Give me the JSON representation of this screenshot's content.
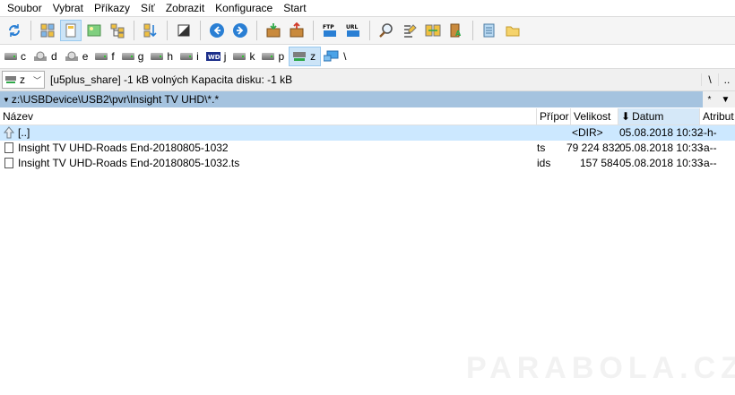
{
  "menu": [
    "Soubor",
    "Vybrat",
    "Příkazy",
    "Síť",
    "Zobrazit",
    "Konfigurace",
    "Start"
  ],
  "drives": [
    {
      "letter": "c",
      "icon": "hdd-icon"
    },
    {
      "letter": "d",
      "icon": "cd-drive-icon"
    },
    {
      "letter": "e",
      "icon": "cd-drive-icon"
    },
    {
      "letter": "f",
      "icon": "hdd-icon"
    },
    {
      "letter": "g",
      "icon": "hdd-icon"
    },
    {
      "letter": "h",
      "icon": "hdd-icon"
    },
    {
      "letter": "i",
      "icon": "hdd-icon"
    },
    {
      "letter": "j",
      "icon": "wd-drive-icon"
    },
    {
      "letter": "k",
      "icon": "hdd-icon"
    },
    {
      "letter": "p",
      "icon": "hdd-icon"
    },
    {
      "letter": "z",
      "icon": "network-drive-icon"
    },
    {
      "letter": "\\",
      "icon": "network-icon"
    }
  ],
  "drive_select": "z",
  "info": "[u5plus_share]  -1 kB volných  Kapacita disku: -1 kB",
  "info_right": [
    "\\",
    ".."
  ],
  "path": "z:\\USBDevice\\USB2\\pvr\\Insight TV UHD\\*.*",
  "path_right": [
    "*",
    "▼"
  ],
  "columns": {
    "name": "Název",
    "ext": "Přípor",
    "size": "Velikost",
    "date": "Datum",
    "attr": "Atribut"
  },
  "files": [
    {
      "name": "[..]",
      "ext": "",
      "size": "<DIR>",
      "date": "05.08.2018 10:32",
      "attr": "--h-",
      "icon": "up-dir-icon"
    },
    {
      "name": "Insight TV UHD-Roads End-20180805-1032",
      "ext": "ts",
      "size": "79 224 832",
      "date": "05.08.2018 10:33",
      "attr": "-a--",
      "icon": "file-icon"
    },
    {
      "name": "Insight TV UHD-Roads End-20180805-1032.ts",
      "ext": "ids",
      "size": "157 584",
      "date": "05.08.2018 10:33",
      "attr": "-a--",
      "icon": "file-icon"
    }
  ],
  "watermark": "PARABOLA.CZ",
  "colors": {
    "path_bar": "#a5c3df",
    "selection": "#cce8ff",
    "active_button": "#cce4f7"
  }
}
